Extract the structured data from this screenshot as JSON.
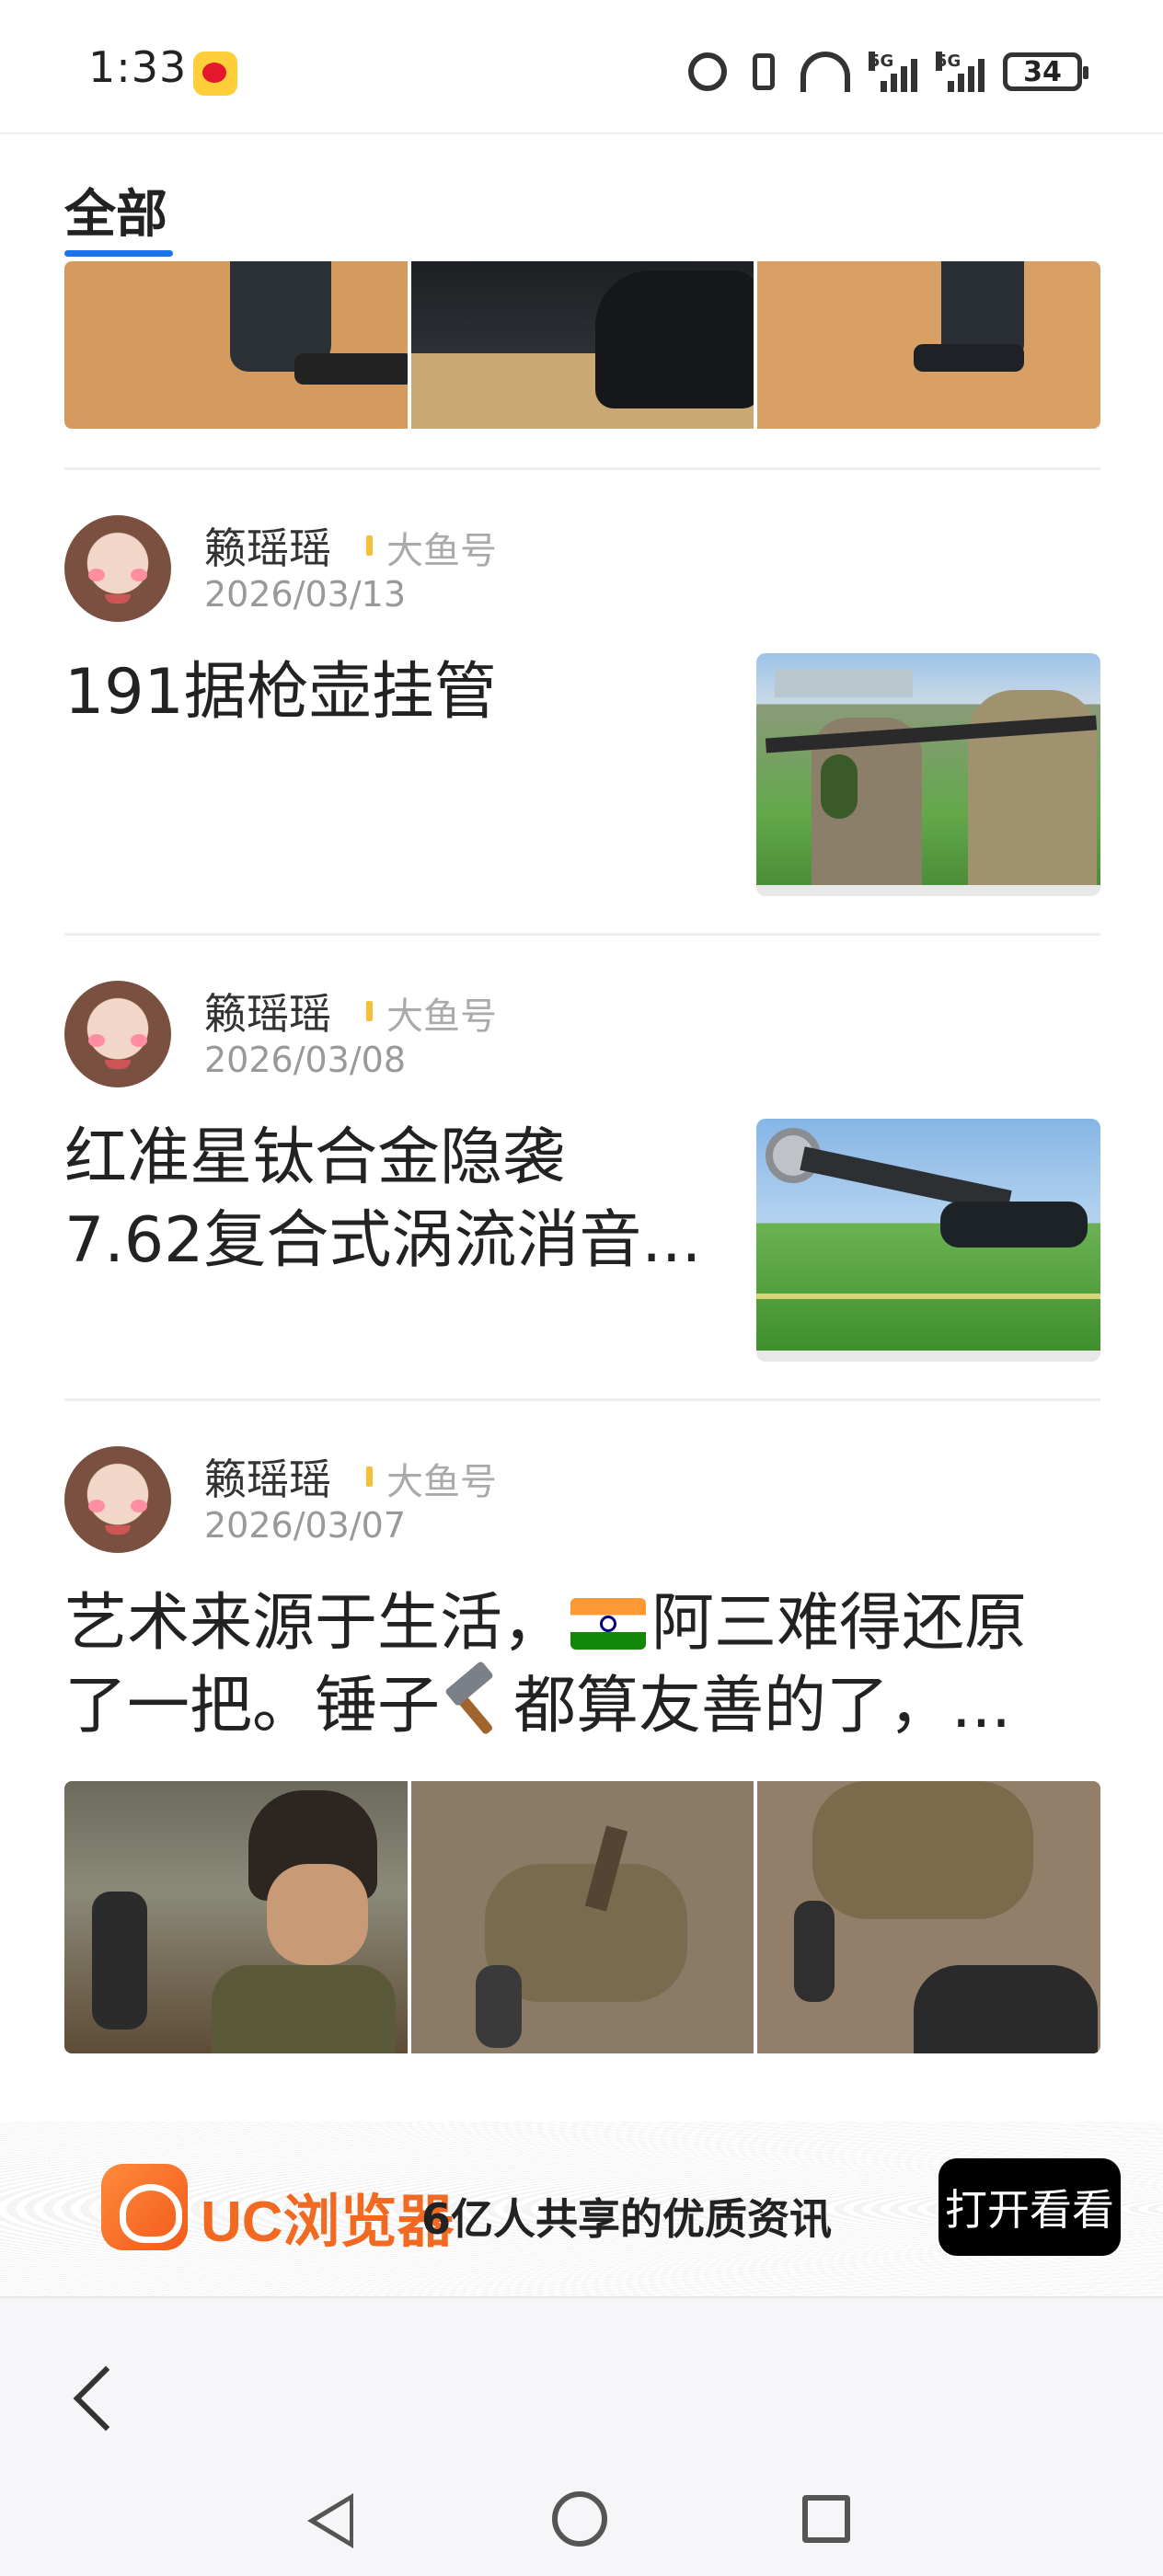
{
  "status_bar": {
    "time": "1:33",
    "signal_1": "5G",
    "signal_2": "5G",
    "battery": "34"
  },
  "tabs": {
    "active": "全部"
  },
  "articles": [
    {
      "author": "籁瑶瑶",
      "source": "大鱼号",
      "date": "2026/03/13",
      "title": "191据枪壶挂管"
    },
    {
      "author": "籁瑶瑶",
      "source": "大鱼号",
      "date": "2026/03/08",
      "title_line1": "红准星钛合金隐袭",
      "title_line2": "7.62复合式涡流消音..."
    },
    {
      "author": "籁瑶瑶",
      "source": "大鱼号",
      "date": "2026/03/07",
      "title_line1_a": "艺术来源于生活，",
      "title_line1_b": "阿三难得还原",
      "title_line2_a": "了一把。锤子",
      "title_line2_b": "都算友善的了，..."
    }
  ],
  "ad": {
    "brand": "UC浏览器",
    "slogan": "6亿人共享的优质资讯",
    "button": "打开看看"
  },
  "icons": {
    "back": "chevron-left-icon",
    "nav_back": "triangle-back-icon",
    "nav_home": "circle-home-icon",
    "nav_recent": "square-recent-icon"
  }
}
